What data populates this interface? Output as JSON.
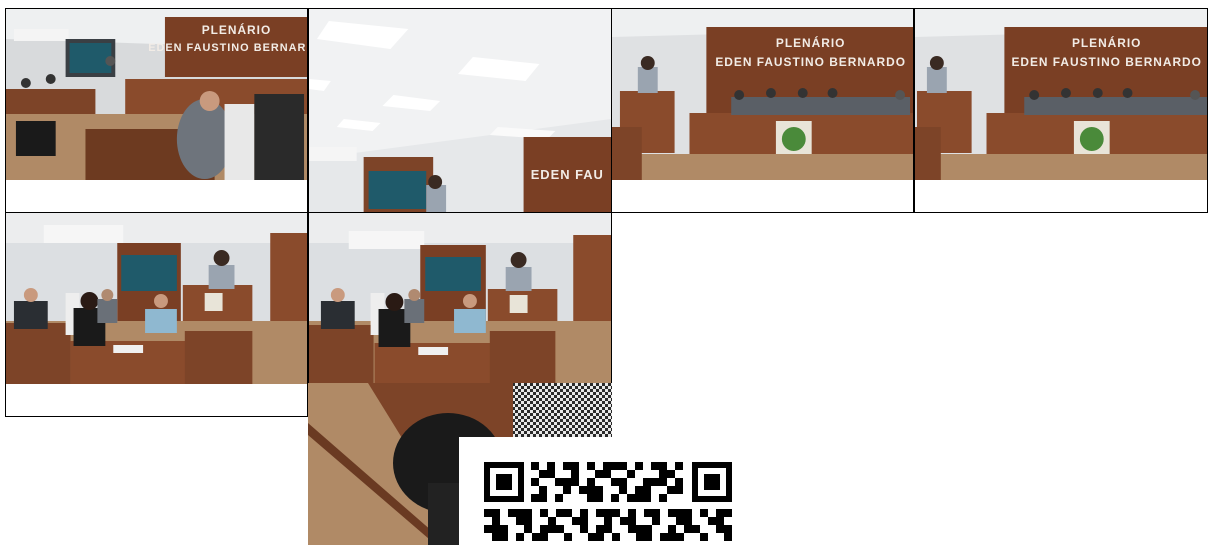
{
  "page": {
    "background": "#ffffff"
  },
  "photos": [
    {
      "id": 1,
      "sign_line1": "PLENÁRIO",
      "sign_line2": "EDEN FAUSTINO BERNARDO"
    },
    {
      "id": 2,
      "sign_line1": "",
      "sign_line2": "EDEN FAU"
    },
    {
      "id": 3,
      "sign_line1": "PLENÁRIO",
      "sign_line2": "EDEN FAUSTINO BERNARDO"
    },
    {
      "id": 4,
      "sign_line1": "PLENÁRIO",
      "sign_line2": "EDEN FAUSTINO BERNARDO"
    },
    {
      "id": 5
    },
    {
      "id": 6
    },
    {
      "id": 7
    }
  ],
  "qr_code": {
    "icon": "qr-code-icon"
  },
  "colors": {
    "wood": "#8a4b2c",
    "wall": "#dcdfe2",
    "floor": "#b08a66",
    "screen": "#1f5a6a"
  }
}
